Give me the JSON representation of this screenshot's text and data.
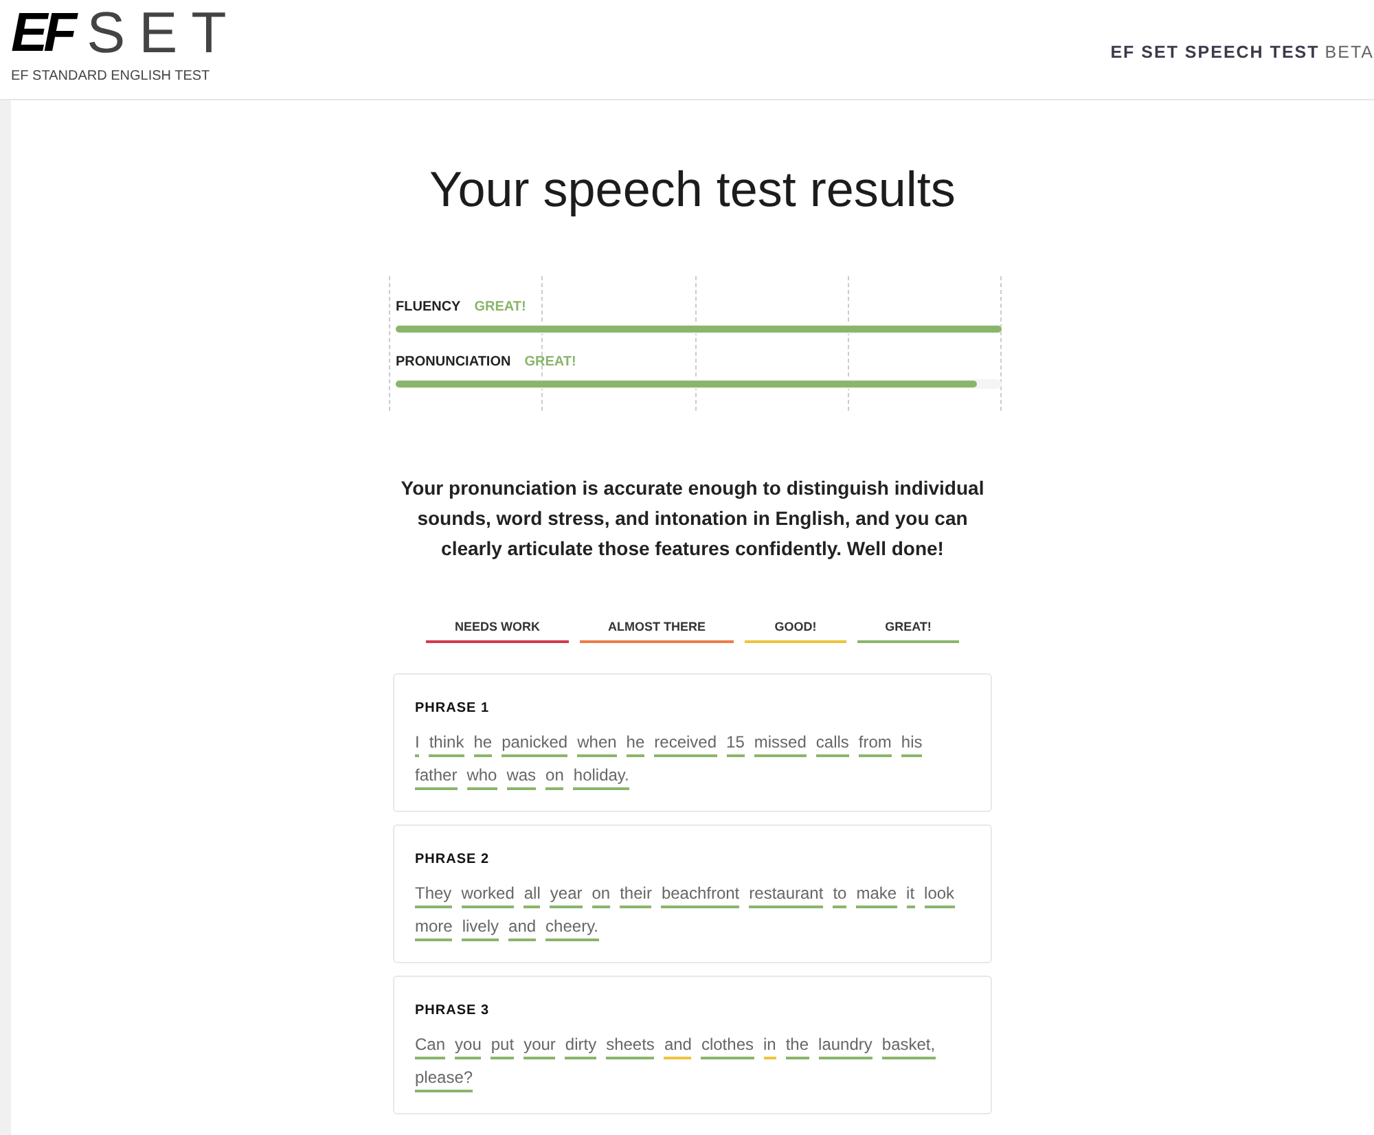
{
  "header": {
    "logo_mark": "EF",
    "logo_word": "SET",
    "tagline": "EF STANDARD ENGLISH TEST",
    "product": "EF SET SPEECH TEST",
    "badge": "BETA"
  },
  "title": "Your speech test results",
  "scores": [
    {
      "label": "FLUENCY",
      "rating": "GREAT!",
      "level": 1.0,
      "color": "#8ab56a"
    },
    {
      "label": "PRONUNCIATION",
      "rating": "GREAT!",
      "level": 0.96,
      "color": "#8ab56a"
    }
  ],
  "summary": "Your pronunciation is accurate enough to distinguish individual sounds, word stress, and intonation in English, and you can clearly articulate those features confidently. Well done!",
  "legend": [
    {
      "label": "NEEDS WORK",
      "color": "#d23a4e"
    },
    {
      "label": "ALMOST THERE",
      "color": "#ee7b47"
    },
    {
      "label": "GOOD!",
      "color": "#eec43c"
    },
    {
      "label": "GREAT!",
      "color": "#8ab56a"
    }
  ],
  "phrases": [
    {
      "title": "PHRASE 1",
      "words": [
        {
          "text": "I",
          "color": "#8ab56a"
        },
        {
          "text": "think",
          "color": "#8ab56a"
        },
        {
          "text": "he",
          "color": "#8ab56a"
        },
        {
          "text": "panicked",
          "color": "#8ab56a"
        },
        {
          "text": "when",
          "color": "#8ab56a"
        },
        {
          "text": "he",
          "color": "#8ab56a"
        },
        {
          "text": "received",
          "color": "#8ab56a"
        },
        {
          "text": "15",
          "color": "#8ab56a"
        },
        {
          "text": "missed",
          "color": "#8ab56a"
        },
        {
          "text": "calls",
          "color": "#8ab56a"
        },
        {
          "text": "from",
          "color": "#8ab56a"
        },
        {
          "text": "his",
          "color": "#8ab56a"
        },
        {
          "text": "father",
          "color": "#8ab56a"
        },
        {
          "text": "who",
          "color": "#8ab56a"
        },
        {
          "text": "was",
          "color": "#8ab56a"
        },
        {
          "text": "on",
          "color": "#8ab56a"
        },
        {
          "text": "holiday.",
          "color": "#8ab56a"
        }
      ]
    },
    {
      "title": "PHRASE 2",
      "words": [
        {
          "text": "They",
          "color": "#8ab56a"
        },
        {
          "text": "worked",
          "color": "#8ab56a"
        },
        {
          "text": "all",
          "color": "#8ab56a"
        },
        {
          "text": "year",
          "color": "#8ab56a"
        },
        {
          "text": "on",
          "color": "#8ab56a"
        },
        {
          "text": "their",
          "color": "#8ab56a"
        },
        {
          "text": "beachfront",
          "color": "#8ab56a"
        },
        {
          "text": "restaurant",
          "color": "#8ab56a"
        },
        {
          "text": "to",
          "color": "#8ab56a"
        },
        {
          "text": "make",
          "color": "#8ab56a"
        },
        {
          "text": "it",
          "color": "#8ab56a"
        },
        {
          "text": "look",
          "color": "#8ab56a"
        },
        {
          "text": "more",
          "color": "#8ab56a"
        },
        {
          "text": "lively",
          "color": "#8ab56a"
        },
        {
          "text": "and",
          "color": "#8ab56a"
        },
        {
          "text": "cheery.",
          "color": "#8ab56a"
        }
      ]
    },
    {
      "title": "PHRASE 3",
      "words": [
        {
          "text": "Can",
          "color": "#8ab56a"
        },
        {
          "text": "you",
          "color": "#8ab56a"
        },
        {
          "text": "put",
          "color": "#8ab56a"
        },
        {
          "text": "your",
          "color": "#8ab56a"
        },
        {
          "text": "dirty",
          "color": "#8ab56a"
        },
        {
          "text": "sheets",
          "color": "#8ab56a"
        },
        {
          "text": "and",
          "color": "#eec43c"
        },
        {
          "text": "clothes",
          "color": "#8ab56a"
        },
        {
          "text": "in",
          "color": "#eec43c"
        },
        {
          "text": "the",
          "color": "#8ab56a"
        },
        {
          "text": "laundry",
          "color": "#8ab56a"
        },
        {
          "text": "basket,",
          "color": "#8ab56a"
        },
        {
          "text": "please?",
          "color": "#8ab56a"
        }
      ]
    }
  ]
}
